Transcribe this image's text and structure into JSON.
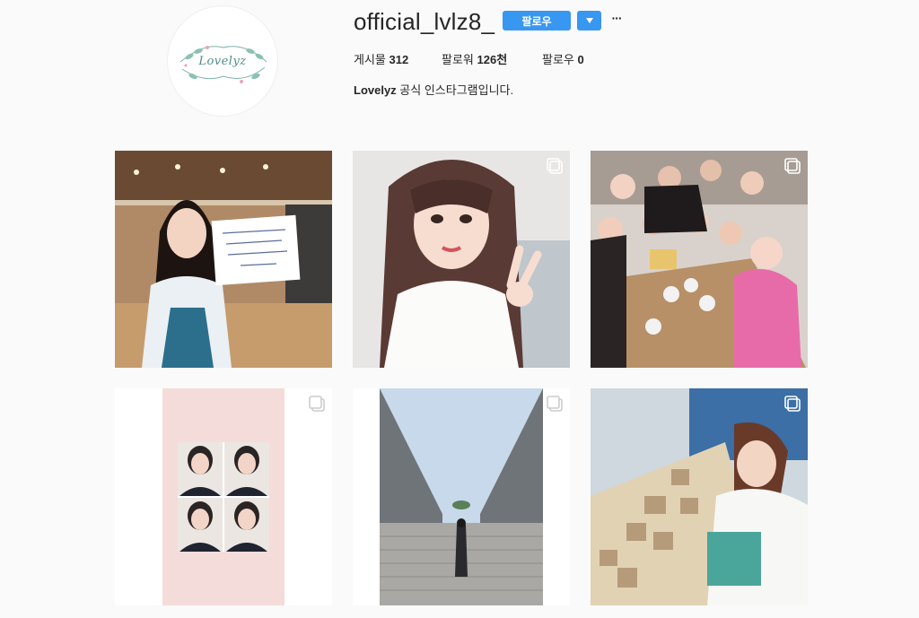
{
  "profile": {
    "username": "official_lvlz8_",
    "logo_text": "Lovelyz",
    "follow_label": "팔로우",
    "dropdown_icon": "triangle-down-icon",
    "more_icon": "ellipsis-icon",
    "more_label": "···",
    "stats": [
      {
        "label": "게시물",
        "value": "312"
      },
      {
        "label": "팔로워",
        "value": "126천"
      },
      {
        "label": "팔로우",
        "value": "0"
      }
    ],
    "bio_name": "Lovelyz",
    "bio_text": " 공식 인스타그램입니다."
  },
  "colors": {
    "accent": "#3897f0",
    "logo": "#4f8d85"
  },
  "posts": [
    {
      "subject": "studio-selfie-with-letter",
      "multi": false
    },
    {
      "subject": "selfie-v-sign",
      "multi": true
    },
    {
      "subject": "group-dinner-table",
      "multi": true
    },
    {
      "subject": "four-photo-booth-grid",
      "multi": true
    },
    {
      "subject": "stairs-between-buildings",
      "multi": true
    },
    {
      "subject": "girl-with-name-blocks",
      "multi": true
    }
  ]
}
